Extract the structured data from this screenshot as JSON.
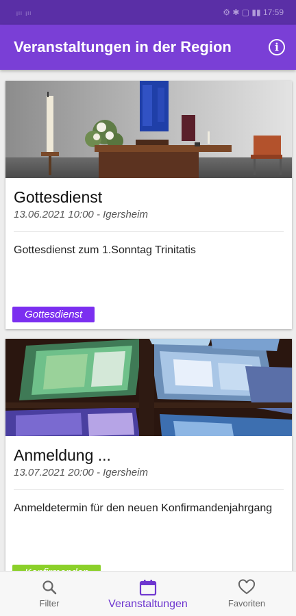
{
  "status_bar": {
    "left": "ᵢₗₗ ᵢₗₗ",
    "right": "⚙ ✱ ▢ ▮▮ 17:59"
  },
  "app_bar": {
    "title": "Veranstaltungen in der Region",
    "info_glyph": "i"
  },
  "events": [
    {
      "title": "Gottesdienst",
      "meta": "13.06.2021 10:00 - Igersheim",
      "description": "Gottesdienst zum 1.Sonntag Trinitatis",
      "tag": "Gottesdienst",
      "tag_color": "#7b2ff0"
    },
    {
      "title": "Anmeldung ...",
      "meta": "13.07.2021 20:00 - Igersheim",
      "description": "Anmeldetermin für den neuen Konfirmandenjahrgang",
      "tag": "Konfirmanden",
      "tag_color": "#8bd02a"
    }
  ],
  "bottom_nav": {
    "filter": "Filter",
    "events": "Veranstaltungen",
    "favorites": "Favoriten"
  },
  "colors": {
    "primary": "#7a3fd6",
    "status_bar": "#5a2fa6",
    "active": "#6e36cf"
  }
}
